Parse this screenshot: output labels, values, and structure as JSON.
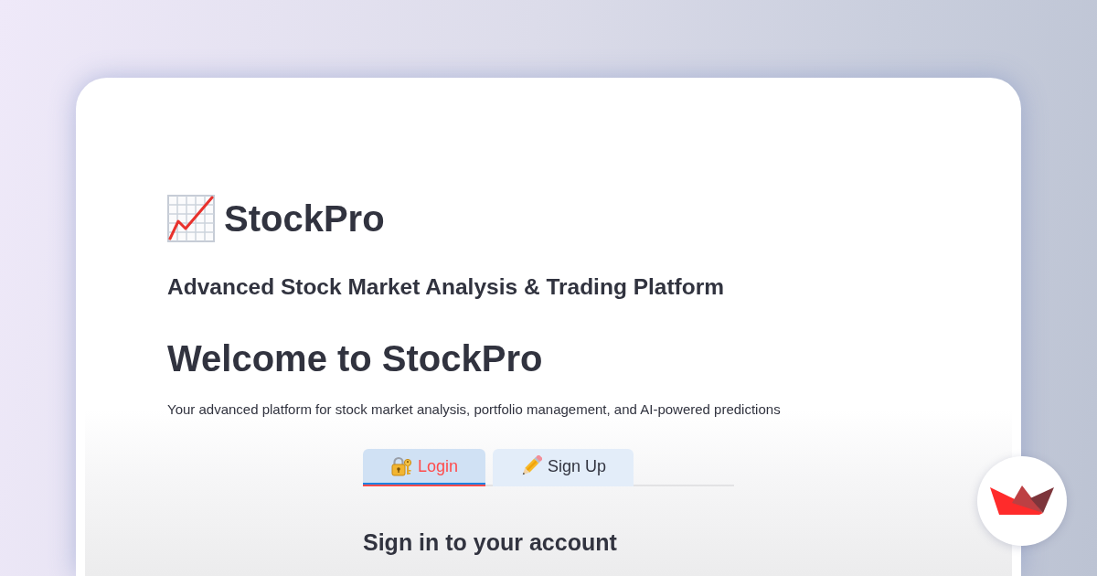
{
  "brand": {
    "title": "StockPro"
  },
  "subtitle": "Advanced Stock Market Analysis & Trading Platform",
  "welcome": {
    "heading": "Welcome to StockPro",
    "text": "Your advanced platform for stock market analysis, portfolio management, and AI-powered predictions"
  },
  "tabs": [
    {
      "label": "Login",
      "kind": "lock",
      "selected": true
    },
    {
      "label": "Sign Up",
      "kind": "pencil",
      "selected": false
    }
  ],
  "form": {
    "heading": "Sign in to your account"
  }
}
